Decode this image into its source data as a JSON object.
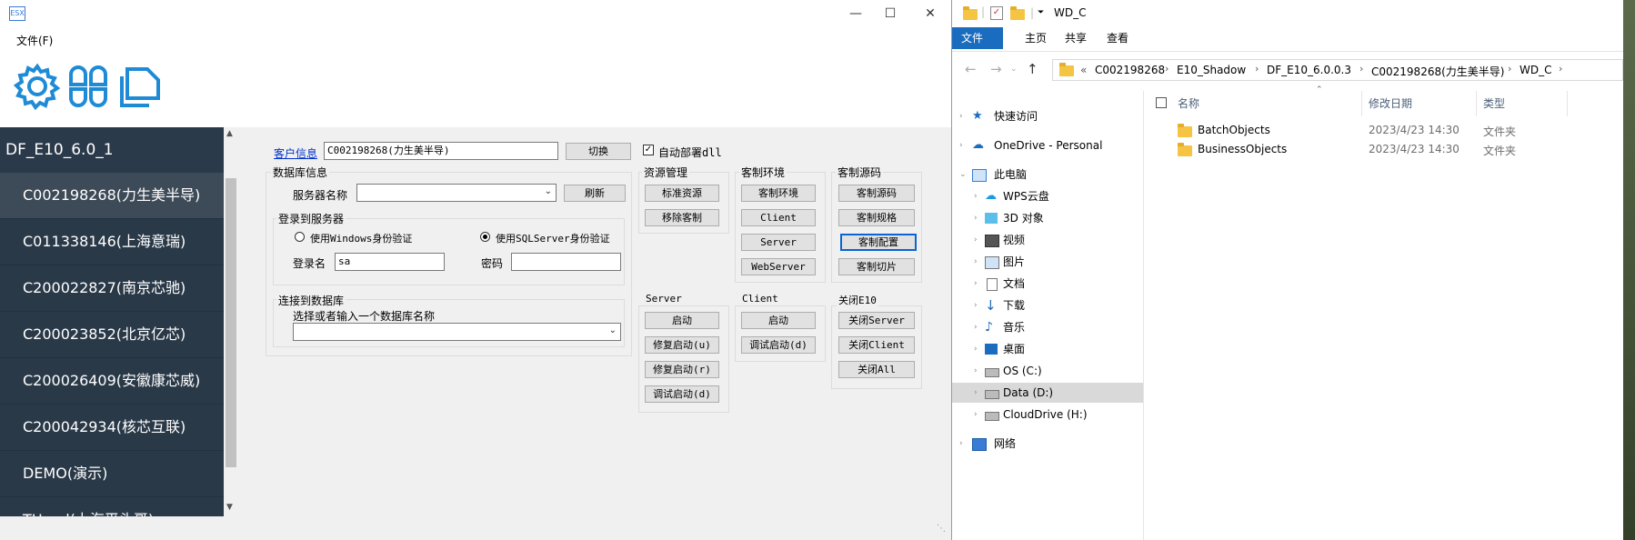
{
  "app": {
    "icon_text": "ESX",
    "menu_file": "文件(F)",
    "sidebar": {
      "header": "DF_E10_6.0_1",
      "items": [
        "C002198268(力生美半导)",
        "C011338146(上海意瑞)",
        "C200022827(南京芯驰)",
        "C200023852(北京亿芯)",
        "C200026409(安徽康芯威)",
        "C200042934(核芯互联)",
        "DEMO(演示)",
        "THead(上海平头哥)"
      ],
      "selected_index": 0
    },
    "customer": {
      "link_label": "客户信息",
      "value": "C002198268(力生美半导)",
      "switch_button": "切换",
      "auto_deploy_label": "自动部署dll",
      "auto_deploy_checked": true
    },
    "db": {
      "group_title": "数据库信息",
      "server_name_label": "服务器名称",
      "server_name_value": "",
      "refresh_button": "刷新",
      "login_group_title": "登录到服务器",
      "windows_auth_label": "使用Windows身份验证",
      "sql_auth_label": "使用SQLServer身份验证",
      "auth_mode": "sql",
      "login_name_label": "登录名",
      "login_name_value": "sa",
      "password_label": "密码",
      "password_value": "",
      "connect_group_title": "连接到数据库",
      "select_db_label": "选择或者输入一个数据库名称",
      "select_db_value": ""
    },
    "resource": {
      "title": "资源管理",
      "buttons": [
        "标准资源",
        "移除客制"
      ]
    },
    "custom_env": {
      "title": "客制环境",
      "buttons": [
        "客制环境",
        "Client",
        "Server",
        "WebServer"
      ]
    },
    "custom_src": {
      "title": "客制源码",
      "buttons": [
        "客制源码",
        "客制规格",
        "客制配置",
        "客制切片"
      ],
      "focused_index": 2
    },
    "server": {
      "title": "Server",
      "buttons": [
        "启动",
        "修复启动(u)",
        "修复启动(r)",
        "调试启动(d)"
      ]
    },
    "client": {
      "title": "Client",
      "buttons": [
        "启动",
        "调试启动(d)"
      ]
    },
    "close_e10": {
      "title": "关闭E10",
      "buttons": [
        "关闭Server",
        "关闭Client",
        "关闭All"
      ]
    }
  },
  "explorer": {
    "title": "WD_C",
    "ribbon_tabs": [
      "文件",
      "主页",
      "共享",
      "查看"
    ],
    "breadcrumb": [
      "«",
      "C002198268",
      "E10_Shadow",
      "DF_E10_6.0.0.3",
      "C002198268(力生美半导)",
      "WD_C"
    ],
    "nav": [
      {
        "label": "快速访问",
        "icon": "star-icon",
        "indent": 0
      },
      {
        "label": "OneDrive - Personal",
        "icon": "cloud-icon",
        "indent": 0
      },
      {
        "label": "此电脑",
        "icon": "computer-icon",
        "indent": 0
      },
      {
        "label": "WPS云盘",
        "icon": "wps-cloud-icon",
        "indent": 1
      },
      {
        "label": "3D 对象",
        "icon": "cube-icon",
        "indent": 1
      },
      {
        "label": "视频",
        "icon": "video-icon",
        "indent": 1
      },
      {
        "label": "图片",
        "icon": "picture-icon",
        "indent": 1
      },
      {
        "label": "文档",
        "icon": "document-icon",
        "indent": 1
      },
      {
        "label": "下载",
        "icon": "download-icon",
        "indent": 1
      },
      {
        "label": "音乐",
        "icon": "music-icon",
        "indent": 1
      },
      {
        "label": "桌面",
        "icon": "desktop-icon",
        "indent": 1
      },
      {
        "label": "OS (C:)",
        "icon": "drive-icon",
        "indent": 1
      },
      {
        "label": "Data (D:)",
        "icon": "drive-icon",
        "indent": 1
      },
      {
        "label": "CloudDrive (H:)",
        "icon": "drive-icon",
        "indent": 1
      },
      {
        "label": "网络",
        "icon": "network-icon",
        "indent": 0
      }
    ],
    "nav_selected": "Data (D:)",
    "columns": [
      "名称",
      "修改日期",
      "类型"
    ],
    "files": [
      {
        "name": "BatchObjects",
        "date": "2023/4/23 14:30",
        "type": "文件夹"
      },
      {
        "name": "BusinessObjects",
        "date": "2023/4/23 14:30",
        "type": "文件夹"
      }
    ]
  },
  "colors": {
    "sidebar_bg": "#2b3a4a",
    "ribbon_file_bg": "#1a6cbf",
    "accent_blue": "#3a7bd5"
  }
}
